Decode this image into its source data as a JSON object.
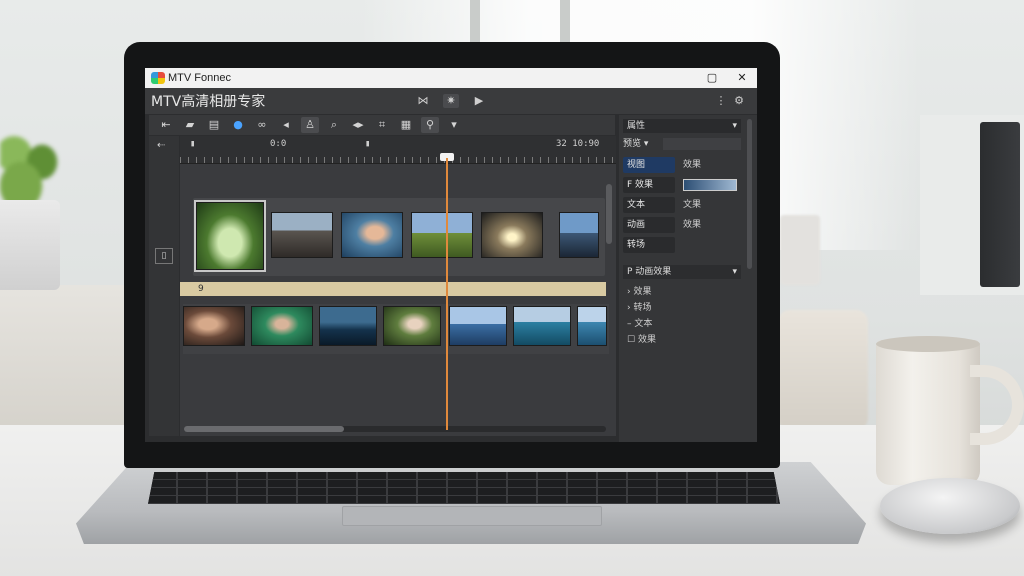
{
  "window": {
    "title": "MTV Fonnec",
    "minimize": "▢",
    "close": "✕"
  },
  "header": {
    "app_name": "MTV高清相册专家",
    "icons": [
      "transition-icon",
      "effects-icon",
      "export-icon",
      "more-icon",
      "settings-icon"
    ]
  },
  "toolbar": {
    "icons": [
      "back-icon",
      "folder-icon",
      "gallery-icon",
      "globe-icon",
      "link-icon",
      "arrow-left-icon",
      "person-icon",
      "zoom-icon",
      "nav-arrows-icon",
      "crop-icon",
      "grid-icon",
      "search-icon",
      "chevron-down-icon"
    ]
  },
  "timeline": {
    "time_left": "0:0",
    "time_right": "32 10:90",
    "audio_label": "9"
  },
  "panel": {
    "dropdown": "属性",
    "sub_dropdown": "预览 ▾",
    "fields": [
      {
        "label": "视图",
        "value": "效果"
      },
      {
        "label": "F 效果",
        "value": ""
      },
      {
        "label": "文本",
        "value": "文果"
      },
      {
        "label": "动画",
        "value": "效果"
      },
      {
        "label": "转场",
        "value": ""
      }
    ],
    "section": "P 动画效果",
    "tree": [
      "效果",
      "转场",
      "文本",
      "效果"
    ]
  },
  "colors": {
    "accent_blue": "#1f3a63",
    "playhead": "#e0893c",
    "audio_track": "#d9caa2"
  }
}
